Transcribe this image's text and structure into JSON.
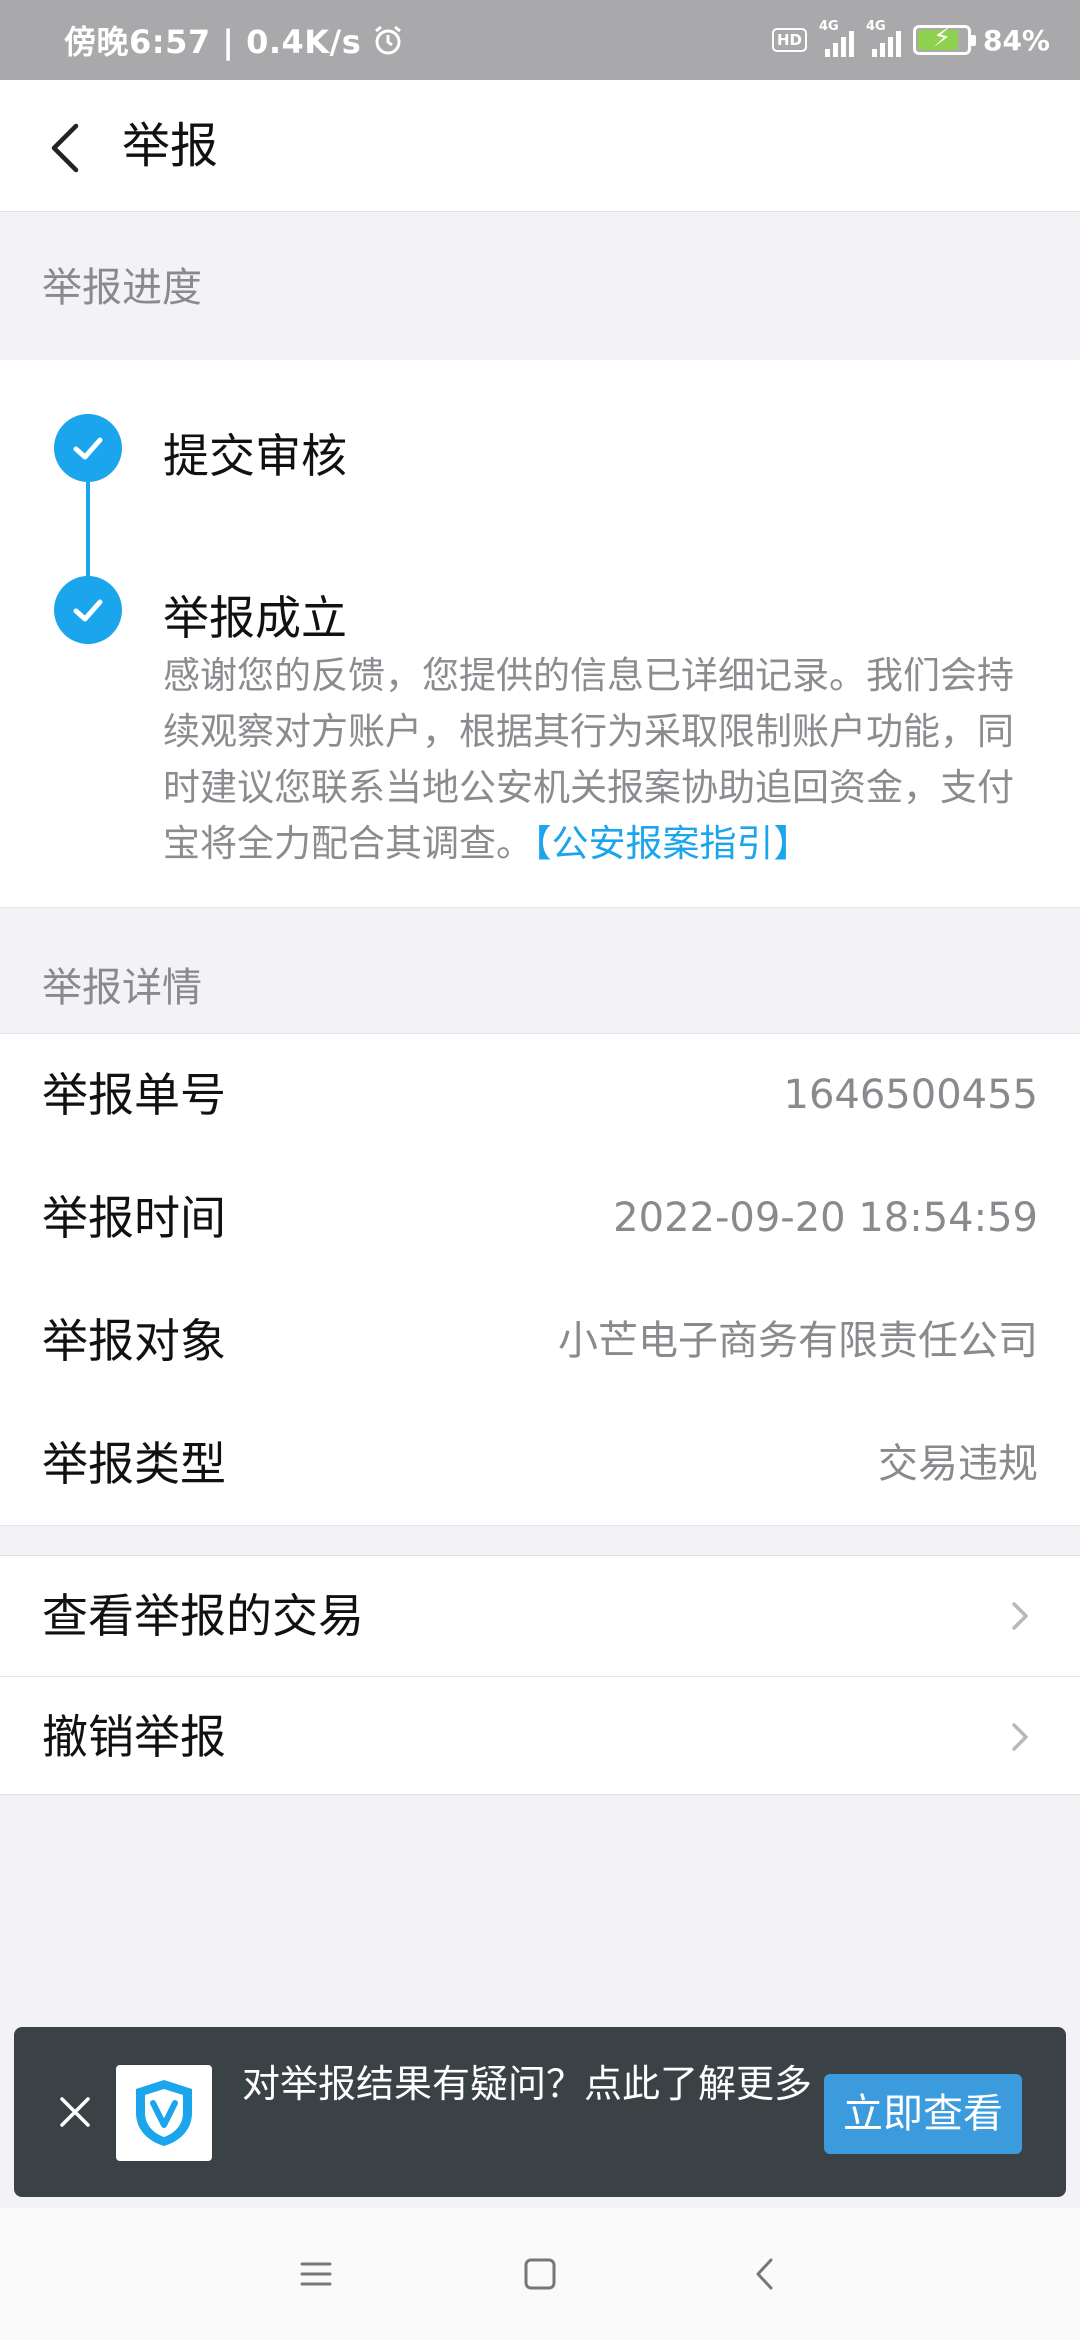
{
  "status_bar": {
    "time_label": "傍晚6:57 | 0.4K/s",
    "hd": "HD",
    "net1": "4G",
    "net2": "4G",
    "battery": "84%",
    "battery_level": 0.84
  },
  "header": {
    "title": "举报"
  },
  "progress": {
    "section_title": "举报进度",
    "steps": [
      {
        "title": "提交审核",
        "done": true
      },
      {
        "title": "举报成立",
        "done": true
      }
    ],
    "description": "感谢您的反馈，您提供的信息已详细记录。我们会持续观察对方账户，根据其行为采取限制账户功能，同时建议您联系当地公安机关报案协助追回资金，支付宝将全力配合其调查。",
    "link_text": "【公安报案指引】"
  },
  "details": {
    "section_title": "举报详情",
    "rows": [
      {
        "label": "举报单号",
        "value": "1646500455"
      },
      {
        "label": "举报时间",
        "value": "2022-09-20 18:54:59"
      },
      {
        "label": "举报对象",
        "value": "小芒电子商务有限责任公司"
      },
      {
        "label": "举报类型",
        "value": "交易违规"
      }
    ]
  },
  "actions": {
    "items": [
      {
        "label": "查看举报的交易"
      },
      {
        "label": "撤销举报"
      }
    ]
  },
  "banner": {
    "text": "对举报结果有疑问？点此了解更多",
    "button_label": "立即查看"
  },
  "colors": {
    "accent": "#1aa5ec",
    "banner_bg": "#3b4246",
    "banner_button": "#3b9bdc"
  }
}
